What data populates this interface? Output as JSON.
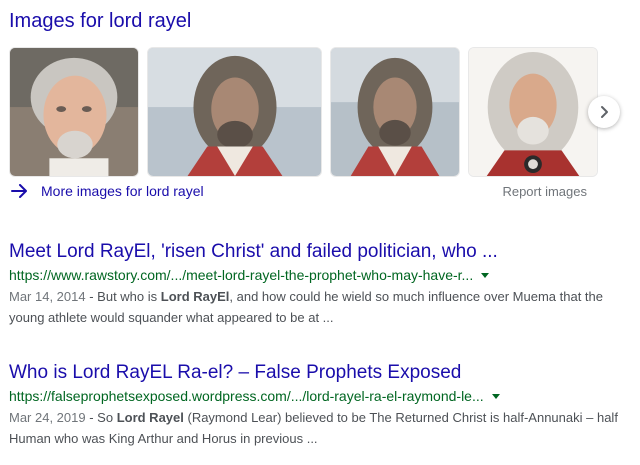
{
  "images_section": {
    "heading": "Images for lord rayel",
    "thumbnails": [
      {
        "alt": "thumbnail-1"
      },
      {
        "alt": "thumbnail-2"
      },
      {
        "alt": "thumbnail-3"
      },
      {
        "alt": "thumbnail-4"
      }
    ],
    "next_icon": "chevron-right-icon",
    "more_images_label": "More images for lord rayel",
    "more_images_icon": "arrow-right-icon",
    "report_label": "Report images"
  },
  "results": [
    {
      "title": "Meet Lord RayEl, 'risen Christ' and failed politician, who ...",
      "url": "https://www.rawstory.com/.../meet-lord-rayel-the-prophet-who-may-have-r...",
      "date": "Mar 14, 2014",
      "snippet_pre": "But who is ",
      "snippet_bold": "Lord RayEl",
      "snippet_post": ", and how could he wield so much influence over Muema that the young athlete would squander what appeared to be at ..."
    },
    {
      "title": "Who is Lord RayEL Ra-el? – False Prophets Exposed",
      "url": "https://falseprophetsexposed.wordpress.com/.../lord-rayel-ra-el-raymond-le...",
      "date": "Mar 24, 2019",
      "snippet_pre": "So ",
      "snippet_bold": "Lord Rayel",
      "snippet_post": " (Raymond Lear) believed to be The Returned Christ is half-Annunaki – half Human who was King Arthur and Horus in previous ..."
    }
  ],
  "colors": {
    "link": "#1a0dab",
    "url": "#006621",
    "snippet": "#4d5156",
    "muted": "#70757a"
  }
}
